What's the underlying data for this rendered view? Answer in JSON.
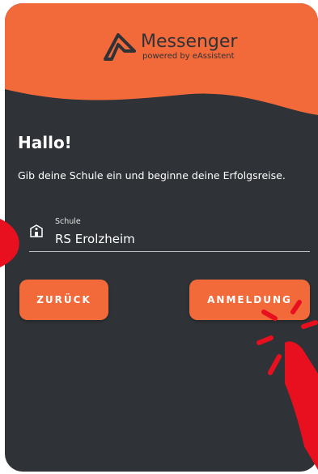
{
  "app": {
    "brand": "Messenger",
    "tagline": "powered by eAssistent"
  },
  "greeting": "Hallo!",
  "intro": "Gib deine Schule ein und beginne deine Erfolgsreise.",
  "school_field": {
    "label": "Schule",
    "value": "RS Erolzheim",
    "icon": "school-icon"
  },
  "buttons": {
    "back": "ZURÜCK",
    "login": "ANMELDUNG"
  },
  "colors": {
    "accent": "#f26a3a",
    "background": "#2f3236",
    "annotation": "#e8101e"
  }
}
